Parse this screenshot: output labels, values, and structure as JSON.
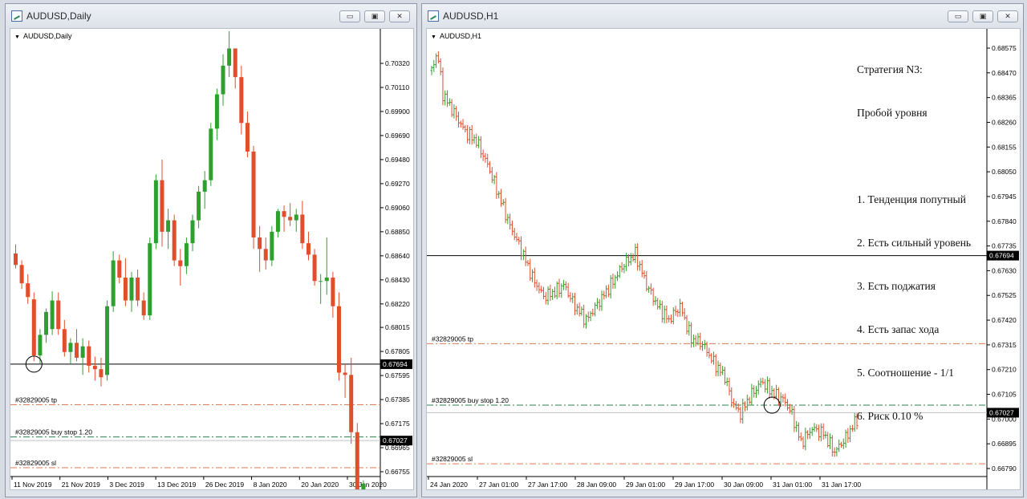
{
  "windows": [
    {
      "title": "AUDUSD,Daily",
      "chart_label": "AUDUSD,Daily",
      "buttons": [
        "▭",
        "▣",
        "✕"
      ]
    },
    {
      "title": "AUDUSD,H1",
      "chart_label": "AUDUSD,H1",
      "buttons": [
        "▭",
        "▣",
        "✕"
      ],
      "strategy_note": {
        "title_lines": [
          "Стратегия N3:",
          "Пробой уровня"
        ],
        "items": [
          "1. Тенденция попутный",
          "2. Есть сильный уровень",
          "3. Есть поджатия",
          "4. Есть запас хода",
          "5. Соотношение - 1/1",
          "6. Риск 0.10 %"
        ]
      }
    }
  ],
  "chart_data": [
    {
      "type": "candlestick",
      "symbol": "AUDUSD",
      "timeframe": "Daily",
      "ylim": [
        0.66755,
        0.70425
      ],
      "y_ticks": [
        "0.70320",
        "0.70110",
        "0.69900",
        "0.69690",
        "0.69480",
        "0.69270",
        "0.69060",
        "0.68850",
        "0.68640",
        "0.68430",
        "0.68220",
        "0.68015",
        "0.67805",
        "0.67595",
        "0.67385",
        "0.67175",
        "0.66965",
        "0.66755"
      ],
      "x_ticks": [
        "11 Nov 2019",
        "21 Nov 2019",
        "3 Dec 2019",
        "13 Dec 2019",
        "26 Dec 2019",
        "8 Jan 2020",
        "20 Jan 2020",
        "30 Jan 2020"
      ],
      "colors": {
        "bull": "#2ea02e",
        "bear": "#e04e2c",
        "level": "#000000",
        "order_line": "#e8845a",
        "buy_stop_line": "#2f8f4f",
        "bid_line": "#c0c0c0"
      },
      "candles": [
        [
          0.6866,
          0.6874,
          0.6853,
          0.6856
        ],
        [
          0.6856,
          0.686,
          0.6835,
          0.684
        ],
        [
          0.684,
          0.6848,
          0.6822,
          0.6828
        ],
        [
          0.6826,
          0.6832,
          0.6772,
          0.6777
        ],
        [
          0.6777,
          0.68,
          0.677,
          0.6795
        ],
        [
          0.6795,
          0.6818,
          0.6788,
          0.6815
        ],
        [
          0.68,
          0.6833,
          0.6795,
          0.6825
        ],
        [
          0.6825,
          0.6832,
          0.6795,
          0.68
        ],
        [
          0.68,
          0.6808,
          0.6776,
          0.678
        ],
        [
          0.678,
          0.6792,
          0.677,
          0.6788
        ],
        [
          0.6788,
          0.68,
          0.6772,
          0.6775
        ],
        [
          0.6775,
          0.6792,
          0.676,
          0.6785
        ],
        [
          0.6785,
          0.679,
          0.6762,
          0.6768
        ],
        [
          0.6768,
          0.6776,
          0.6755,
          0.6765
        ],
        [
          0.6765,
          0.6775,
          0.675,
          0.6758
        ],
        [
          0.676,
          0.6825,
          0.6755,
          0.682
        ],
        [
          0.682,
          0.6868,
          0.6815,
          0.686
        ],
        [
          0.686,
          0.6865,
          0.684,
          0.6845
        ],
        [
          0.6845,
          0.6862,
          0.682,
          0.6825
        ],
        [
          0.6825,
          0.685,
          0.6815,
          0.6845
        ],
        [
          0.6845,
          0.6852,
          0.682,
          0.6825
        ],
        [
          0.6825,
          0.6832,
          0.6808,
          0.6812
        ],
        [
          0.6812,
          0.688,
          0.6808,
          0.6875
        ],
        [
          0.6875,
          0.6935,
          0.687,
          0.693
        ],
        [
          0.693,
          0.6948,
          0.6872,
          0.6885
        ],
        [
          0.6885,
          0.6905,
          0.687,
          0.6895
        ],
        [
          0.6895,
          0.69,
          0.6855,
          0.686
        ],
        [
          0.686,
          0.687,
          0.6838,
          0.6855
        ],
        [
          0.6855,
          0.688,
          0.6848,
          0.6875
        ],
        [
          0.6875,
          0.69,
          0.6868,
          0.6895
        ],
        [
          0.6895,
          0.6925,
          0.6888,
          0.692
        ],
        [
          0.692,
          0.6938,
          0.6905,
          0.693
        ],
        [
          0.693,
          0.698,
          0.6925,
          0.6975
        ],
        [
          0.6975,
          0.701,
          0.6965,
          0.7005
        ],
        [
          0.7005,
          0.704,
          0.6995,
          0.703
        ],
        [
          0.703,
          0.706,
          0.702,
          0.7045
        ],
        [
          0.7045,
          0.704,
          0.701,
          0.702
        ],
        [
          0.702,
          0.703,
          0.697,
          0.698
        ],
        [
          0.698,
          0.699,
          0.695,
          0.6955
        ],
        [
          0.6955,
          0.696,
          0.687,
          0.688
        ],
        [
          0.688,
          0.689,
          0.685,
          0.687
        ],
        [
          0.687,
          0.688,
          0.6852,
          0.686
        ],
        [
          0.686,
          0.689,
          0.6855,
          0.6885
        ],
        [
          0.6885,
          0.6905,
          0.688,
          0.6903
        ],
        [
          0.6903,
          0.6908,
          0.6885,
          0.6898
        ],
        [
          0.6898,
          0.691,
          0.689,
          0.6895
        ],
        [
          0.6895,
          0.6905,
          0.6885,
          0.69
        ],
        [
          0.69,
          0.6912,
          0.687,
          0.6875
        ],
        [
          0.6875,
          0.6885,
          0.686,
          0.6865
        ],
        [
          0.6865,
          0.687,
          0.6838,
          0.6842
        ],
        [
          0.6842,
          0.6848,
          0.6822,
          0.6842
        ],
        [
          0.6842,
          0.688,
          0.683,
          0.6845
        ],
        [
          0.6845,
          0.685,
          0.681,
          0.682
        ],
        [
          0.682,
          0.6832,
          0.6755,
          0.6762
        ],
        [
          0.6762,
          0.677,
          0.674,
          0.676
        ],
        [
          0.676,
          0.6775,
          0.67,
          0.671
        ],
        [
          0.671,
          0.6718,
          0.664,
          0.665
        ],
        [
          0.6652,
          0.6668,
          0.6648,
          0.6665
        ]
      ],
      "levels": [
        {
          "price": 0.67694,
          "label": "0.67694",
          "style": "solid"
        },
        {
          "price": 0.6734,
          "label": "#32829005 tp",
          "style": "dashdot"
        },
        {
          "price": 0.67059,
          "label": "#32829005 buy stop 1.20",
          "style": "dashdot-green"
        },
        {
          "price": 0.67027,
          "label": "0.67027",
          "style": "bid"
        },
        {
          "price": 0.6679,
          "label": "#32829005 sl",
          "style": "dashdot"
        }
      ],
      "marker_circle_candle": 3
    },
    {
      "type": "candlestick",
      "symbol": "AUDUSD",
      "timeframe": "H1",
      "ylim": [
        0.6679,
        0.68575
      ],
      "y_ticks": [
        "0.68575",
        "0.68470",
        "0.68365",
        "0.68260",
        "0.68155",
        "0.68050",
        "0.67945",
        "0.67840",
        "0.67735",
        "0.67630",
        "0.67525",
        "0.67420",
        "0.67315",
        "0.67210",
        "0.67105",
        "0.67000",
        "0.66895",
        "0.66790"
      ],
      "x_ticks": [
        "24 Jan 2020",
        "27 Jan 01:00",
        "27 Jan 17:00",
        "28 Jan 09:00",
        "29 Jan 01:00",
        "29 Jan 17:00",
        "30 Jan 09:00",
        "31 Jan 01:00",
        "31 Jan 17:00"
      ],
      "levels": [
        {
          "price": 0.67694,
          "label": "0.67694",
          "style": "solid"
        },
        {
          "price": 0.6732,
          "label": "#32829005 tp",
          "style": "dashdot"
        },
        {
          "price": 0.67059,
          "label": "#32829005 buy stop 1.20",
          "style": "dashdot-green"
        },
        {
          "price": 0.67027,
          "label": "0.67027",
          "style": "bid"
        },
        {
          "price": 0.6681,
          "label": "#32829005 sl",
          "style": "dashdot"
        }
      ],
      "path": [
        [
          0,
          0.6848
        ],
        [
          5,
          0.6856
        ],
        [
          10,
          0.6838
        ],
        [
          20,
          0.683
        ],
        [
          30,
          0.6822
        ],
        [
          40,
          0.6818
        ],
        [
          50,
          0.6808
        ],
        [
          60,
          0.6795
        ],
        [
          70,
          0.6782
        ],
        [
          80,
          0.6772
        ],
        [
          90,
          0.676
        ],
        [
          100,
          0.6752
        ],
        [
          110,
          0.6754
        ],
        [
          118,
          0.6757
        ],
        [
          128,
          0.6748
        ],
        [
          138,
          0.6742
        ],
        [
          150,
          0.675
        ],
        [
          160,
          0.6757
        ],
        [
          172,
          0.6766
        ],
        [
          182,
          0.677
        ],
        [
          192,
          0.6757
        ],
        [
          202,
          0.6748
        ],
        [
          212,
          0.6742
        ],
        [
          222,
          0.6748
        ],
        [
          232,
          0.6734
        ],
        [
          242,
          0.6732
        ],
        [
          252,
          0.6724
        ],
        [
          262,
          0.6718
        ],
        [
          268,
          0.6708
        ],
        [
          275,
          0.6702
        ],
        [
          285,
          0.671
        ],
        [
          295,
          0.6716
        ],
        [
          305,
          0.6711
        ],
        [
          315,
          0.6708
        ],
        [
          322,
          0.6702
        ],
        [
          330,
          0.669
        ],
        [
          340,
          0.6696
        ],
        [
          350,
          0.6694
        ],
        [
          360,
          0.6686
        ],
        [
          370,
          0.6692
        ],
        [
          380,
          0.67
        ]
      ],
      "path_total_bars": 380,
      "marker_circle_bar": 302
    }
  ]
}
